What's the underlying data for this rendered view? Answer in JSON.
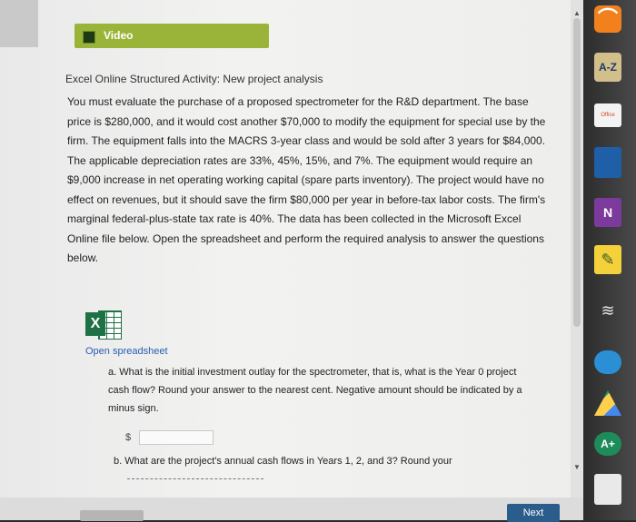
{
  "video": {
    "label": "Video"
  },
  "activity": {
    "title": "Excel Online Structured Activity: New project analysis"
  },
  "problem": {
    "text": "You must evaluate the purchase of a proposed spectrometer for the R&D department. The base price is $280,000, and it would cost another $70,000 to modify the equipment for special use by the firm. The equipment falls into the MACRS 3-year class and would be sold after 3 years for $84,000. The applicable depreciation rates are 33%, 45%, 15%, and 7%. The equipment would require an $9,000 increase in net operating working capital (spare parts inventory). The project would have no effect on revenues, but it should save the firm $80,000 per year in before-tax labor costs. The firm's marginal federal-plus-state tax rate is 40%. The data has been collected in the Microsoft Excel Online file below. Open the spreadsheet and perform the required analysis to answer the questions below."
  },
  "spreadsheet": {
    "link_label": "Open spreadsheet",
    "icon_letter": "X"
  },
  "question_a": {
    "text": "a. What is the initial investment outlay for the spectrometer, that is, what is the Year 0 project cash flow? Round your answer to the nearest cent. Negative amount should be indicated by a minus sign.",
    "currency": "$",
    "input_value": ""
  },
  "question_b": {
    "text": "b. What are the project's annual cash flows in Years 1, 2, and 3? Round your"
  },
  "nav": {
    "next_label": "Next"
  },
  "scrollbar": {
    "up_arrow": "▲",
    "down_arrow": "▼"
  },
  "dock": {
    "icons": [
      {
        "name": "rss-icon",
        "glyph": "⌒"
      },
      {
        "name": "a-z-icon",
        "label": "A-Z"
      },
      {
        "name": "office-icon",
        "label": "Office"
      },
      {
        "name": "onenote-icon",
        "label": "N"
      },
      {
        "name": "grammarly-icon",
        "label": "A+"
      }
    ]
  },
  "colors": {
    "video_button": "#9ab43a",
    "link": "#2a5db0",
    "next_button": "#2a5d8c",
    "excel_green": "#1e7145"
  }
}
